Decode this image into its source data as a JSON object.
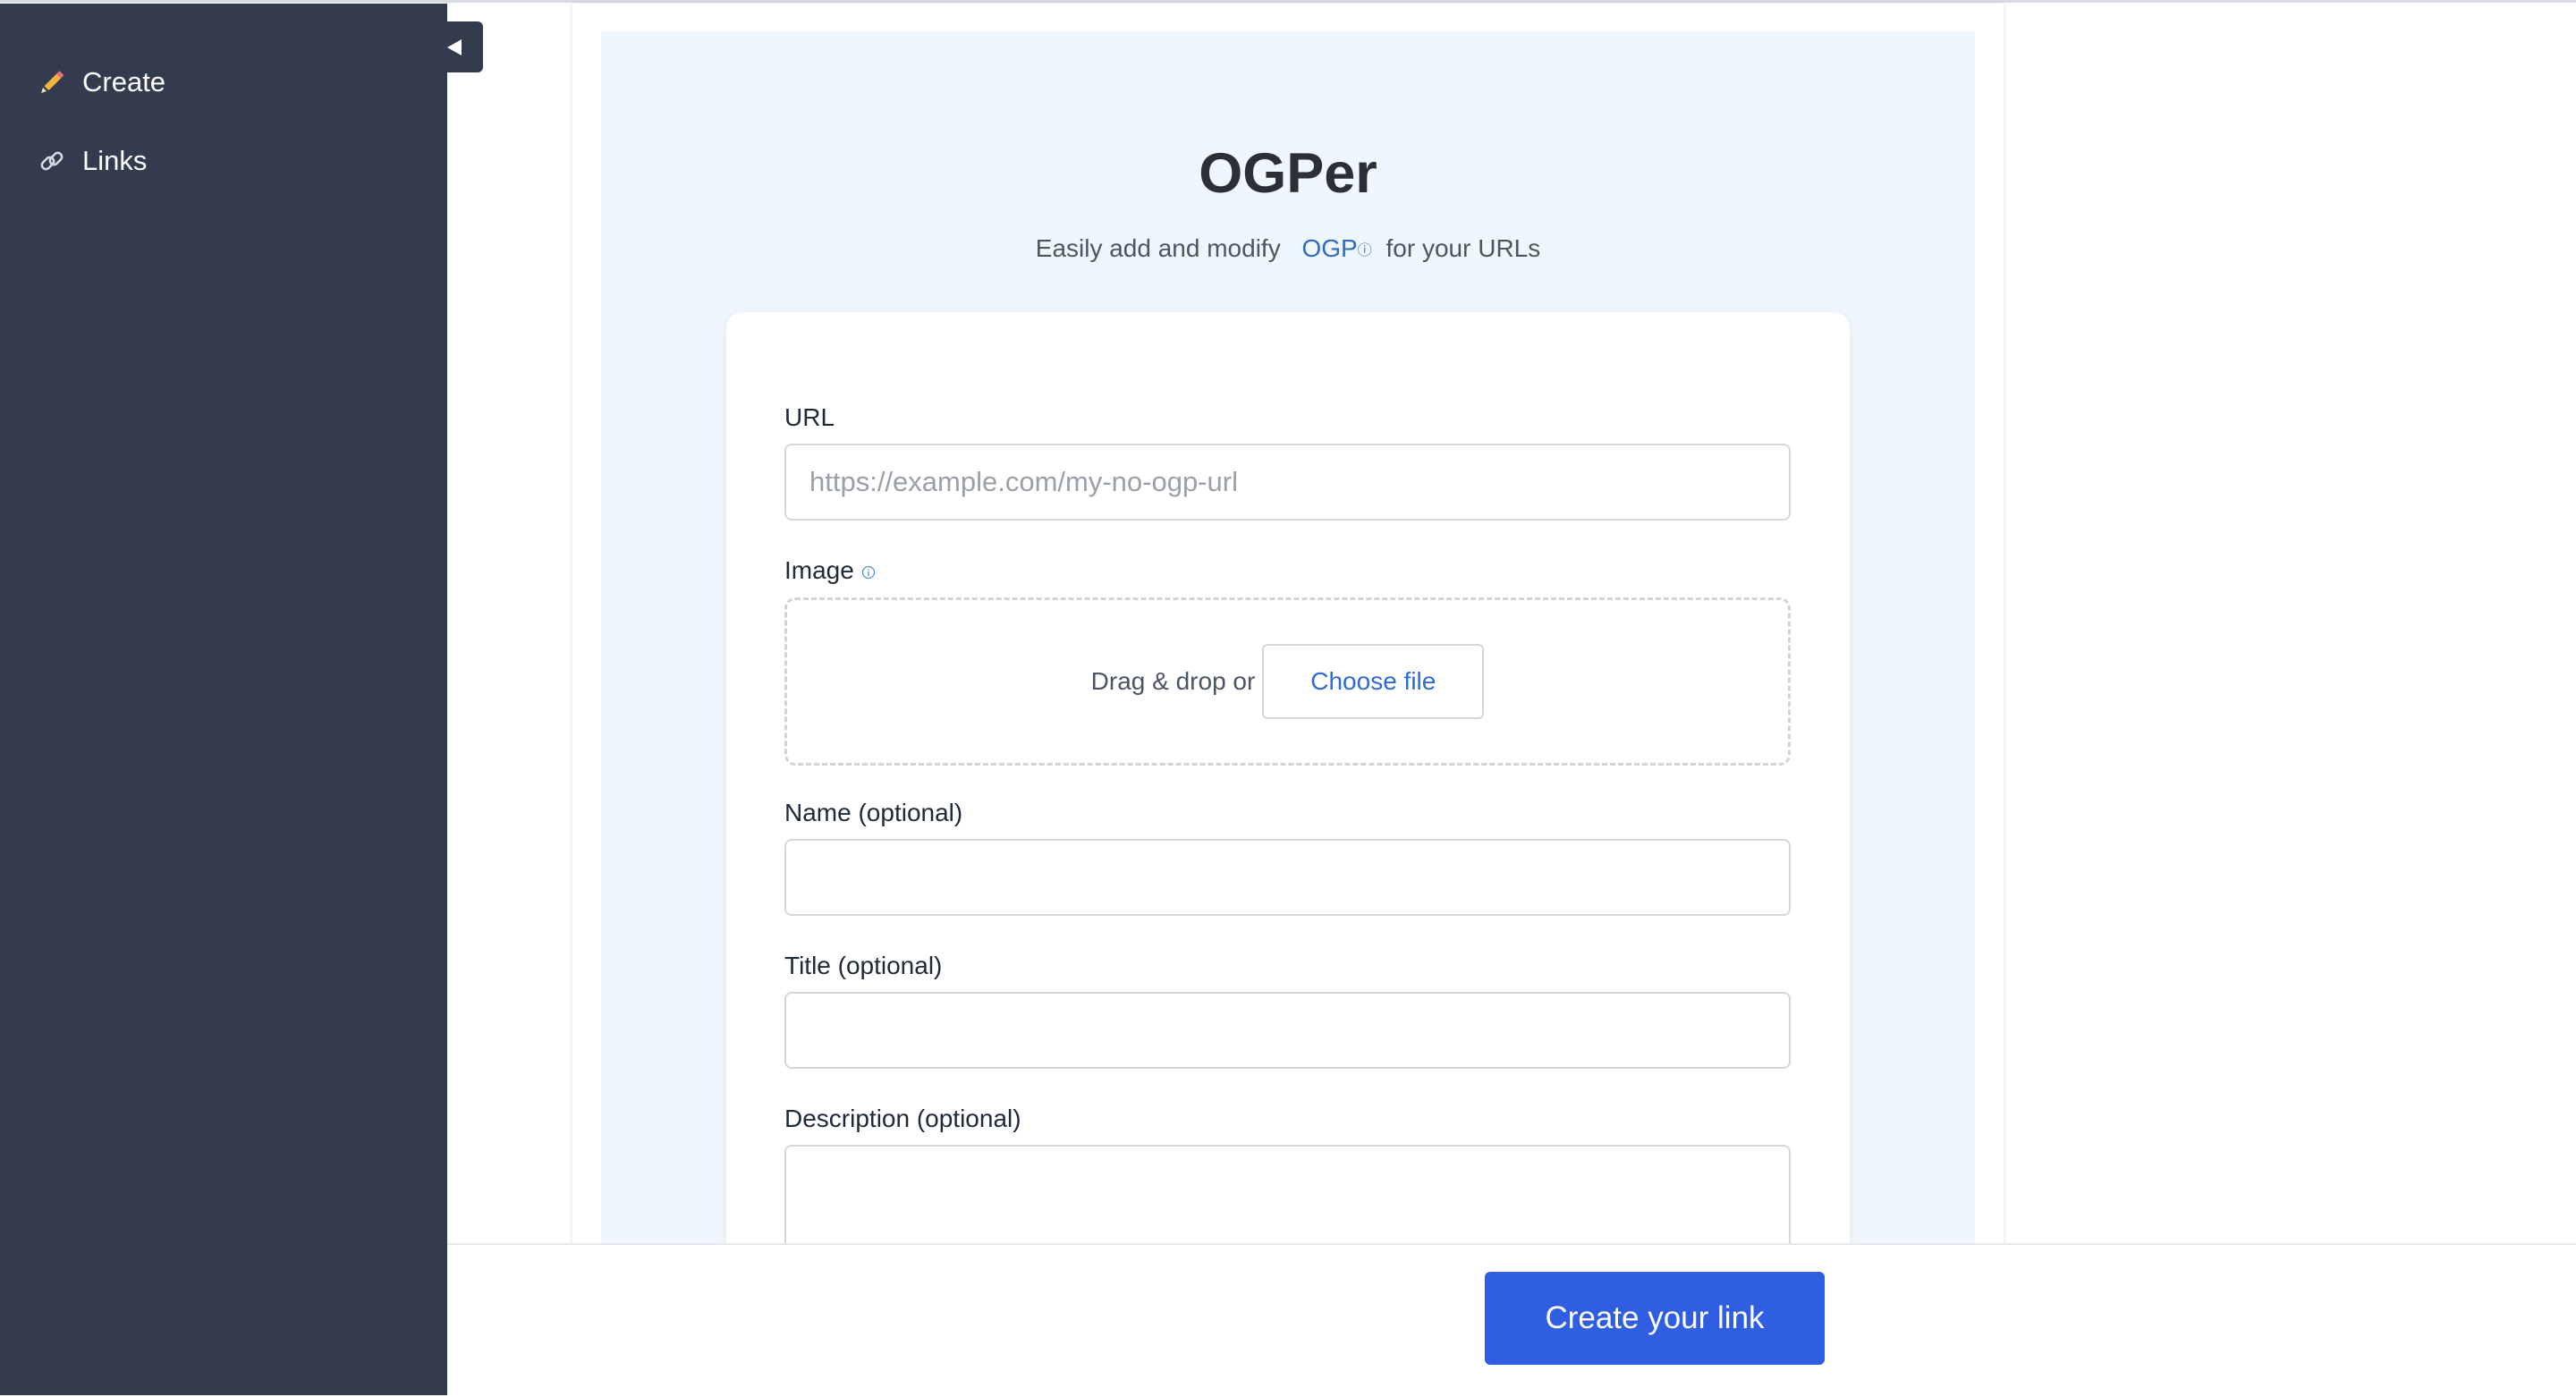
{
  "sidebar": {
    "items": [
      {
        "label": "Create",
        "icon": "pencil-icon"
      },
      {
        "label": "Links",
        "icon": "link-icon"
      }
    ],
    "collapse_icon": "collapse-left-icon"
  },
  "header": {
    "title": "OGPer",
    "subtitle_before": "Easily add and modify",
    "subtitle_link": "OGP",
    "subtitle_after": "for your URLs"
  },
  "form": {
    "url_label": "URL",
    "url_placeholder": "https://example.com/my-no-ogp-url",
    "image_label": "Image",
    "drop_text": "Drag & drop or",
    "choose_file": "Choose file",
    "name_label": "Name (optional)",
    "title_label": "Title (optional)",
    "description_label": "Description (optional)"
  },
  "footer": {
    "submit_label": "Create your link"
  },
  "colors": {
    "sidebar": "#323c4e",
    "accent": "#2f5fe0",
    "link": "#2f6bc3",
    "hero_bg": "#eff6fd"
  }
}
